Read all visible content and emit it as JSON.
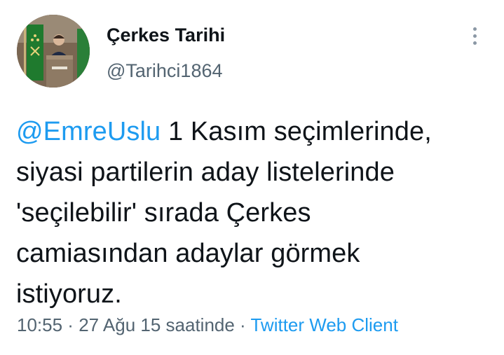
{
  "author": {
    "display_name": "Çerkes Tarihi",
    "handle": "@Tarihci1864"
  },
  "tweet": {
    "mention": "@EmreUslu",
    "lines": [
      " 1 Kasım seçimlerinde,",
      "siyasi partilerin aday listelerinde",
      "'seçilebilir' sırada Çerkes",
      "camiasından adaylar görmek",
      "istiyoruz."
    ]
  },
  "meta": {
    "time": "10:55",
    "separator_1": " · ",
    "date": "27 Ağu 15 saatinde",
    "separator_2": " · ",
    "source": "Twitter Web Client"
  },
  "icons": {
    "more": "more-vertical-icon",
    "avatar": "profile-avatar"
  },
  "colors": {
    "link": "#1d9bf0",
    "secondary_text": "#536471",
    "primary_text": "#0f1419"
  }
}
